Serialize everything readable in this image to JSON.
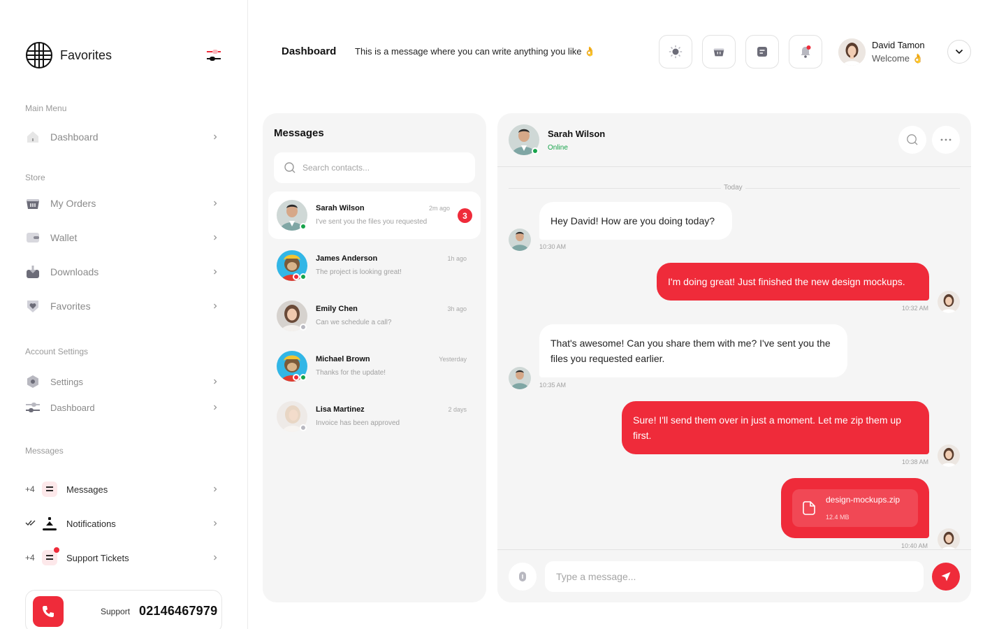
{
  "brand": {
    "name": "Favorites",
    "logo_icon": "grid-globe-icon"
  },
  "sidebar": {
    "sections": {
      "main": "Main Menu",
      "store": "Store",
      "account": "Account Settings",
      "messages": "Messages"
    },
    "main_items": [
      {
        "label": "Dashboard",
        "icon": "home-icon"
      }
    ],
    "store_items": [
      {
        "label": "My Orders",
        "icon": "basket-icon"
      },
      {
        "label": "Wallet",
        "icon": "wallet-icon"
      },
      {
        "label": "Downloads",
        "icon": "download-box-icon"
      },
      {
        "label": "Favorites",
        "icon": "heart-shield-icon"
      }
    ],
    "account_items": [
      {
        "label": "Settings",
        "icon": "hexagon-gear-icon"
      },
      {
        "label": "Dashboard",
        "icon": "sliders-icon"
      }
    ],
    "message_items": [
      {
        "count": "+4",
        "label": "Messages",
        "icon": "lines-icon"
      },
      {
        "count": "",
        "label": "Notifications",
        "icon": "bell-stack-icon"
      },
      {
        "count": "+4",
        "label": "Support Tickets",
        "icon": "ticket-lines-icon"
      }
    ],
    "support": {
      "label": "Support",
      "number": "02146467979"
    }
  },
  "header": {
    "title": "Dashboard",
    "subtitle": "This is a message where you can write anything you like 👌",
    "user": {
      "name": "David Tamon",
      "welcome": "Welcome 👌"
    }
  },
  "messages_panel": {
    "title": "Messages",
    "search_placeholder": "Search contacts...",
    "contacts": [
      {
        "name": "Sarah Wilson",
        "preview": "I've sent you the files you requested",
        "time": "2m ago",
        "badge": "3"
      },
      {
        "name": "James Anderson",
        "preview": "The project is looking great!",
        "time": "1h ago"
      },
      {
        "name": "Emily Chen",
        "preview": "Can we schedule a call?",
        "time": "3h ago"
      },
      {
        "name": "Michael Brown",
        "preview": "Thanks for the update!",
        "time": "Yesterday"
      },
      {
        "name": "Lisa Martinez",
        "preview": "Invoice has been approved",
        "time": "2 days"
      }
    ]
  },
  "chat": {
    "contact_name": "Sarah Wilson",
    "contact_status": "Online",
    "day_label": "Today",
    "messages": [
      {
        "text": "Hey David! How are you doing today?",
        "time": "10:30 AM"
      },
      {
        "text": "I'm doing great! Just finished the new design mockups.",
        "time": "10:32 AM"
      },
      {
        "text": "That's awesome! Can you share them with me? I've sent you the files you requested earlier.",
        "time": "10:35 AM"
      },
      {
        "text": "Sure! I'll send them over in just a moment. Let me zip them up first.",
        "time": "10:38 AM"
      },
      {
        "file_name": "design-mockups.zip",
        "file_size": "12.4 MB",
        "time": "10:40 AM"
      }
    ],
    "input_placeholder": "Type a message..."
  },
  "colors": {
    "accent": "#ef2b3a",
    "online": "#17a34a",
    "panel": "#f5f5f5"
  }
}
